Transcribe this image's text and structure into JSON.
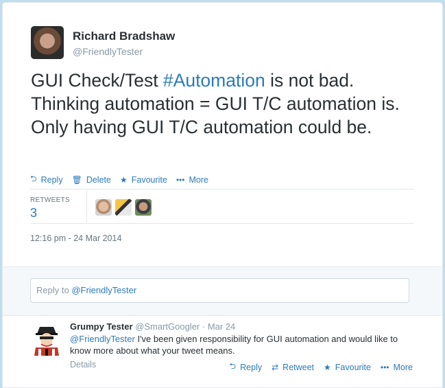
{
  "tweet": {
    "author_name": "Richard Bradshaw",
    "author_handle": "@FriendlyTester",
    "text_before": "GUI Check/Test ",
    "hashtag": "#Automation",
    "text_after": " is not bad. Thinking automation = GUI T/C automation is. Only having GUI T/C automation could be.",
    "actions": {
      "reply": "Reply",
      "delete": "Delete",
      "favourite": "Favourite",
      "more": "More"
    },
    "retweets_label": "RETWEETS",
    "retweets_count": "3",
    "timestamp": "12:16 pm - 24 Mar 2014"
  },
  "reply_box": {
    "prefix": "Reply to ",
    "mention": "@FriendlyTester"
  },
  "reply": {
    "name": "Grumpy Tester",
    "handle": "@SmartGoogler",
    "date": "· Mar 24",
    "mention": "@FriendlyTester",
    "text": " I've been given responsibility for GUI automation and would like to know more about what your tweet means.",
    "details": "Details",
    "actions": {
      "reply": "Reply",
      "retweet": "Retweet",
      "favourite": "Favourite",
      "more": "More"
    }
  },
  "icons": [
    "reply-icon",
    "trash-icon",
    "star-icon",
    "more-dots-icon",
    "retweet-icon"
  ],
  "colors": {
    "link": "#2b7bb9",
    "muted": "#8899a6",
    "background": "#c0deed"
  }
}
